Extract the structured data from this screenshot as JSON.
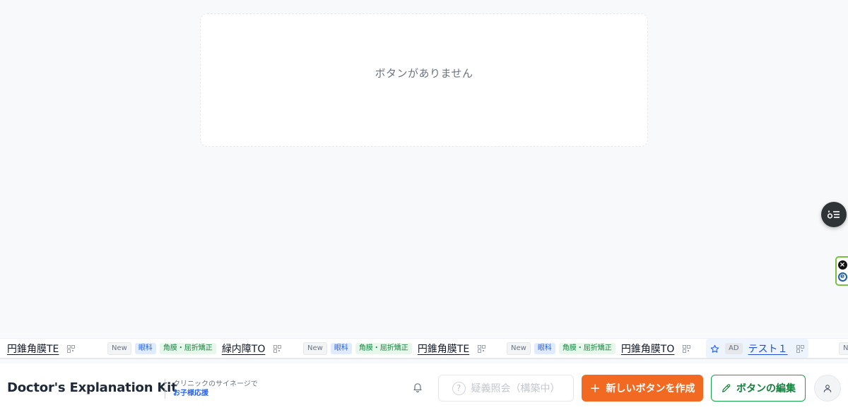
{
  "empty_state": {
    "message": "ボタンがありません"
  },
  "ticker": {
    "items": [
      {
        "title": "円錐角膜TE"
      },
      {
        "badge_new": "New",
        "badge_dept": "眼科",
        "badge_tag": "角膜・屈折矯正",
        "title": "緑内障TO"
      },
      {
        "badge_new": "New",
        "badge_dept": "眼科",
        "badge_tag": "角膜・屈折矯正",
        "title": "円錐角膜TE"
      },
      {
        "badge_new": "New",
        "badge_dept": "眼科",
        "badge_tag": "角膜・屈折矯正",
        "title": "円錐角膜TO"
      },
      {
        "badge_ad": "AD",
        "title": "テスト１"
      },
      {
        "badge_new": "Ne"
      }
    ]
  },
  "bottombar": {
    "brand": "Doctor's Explanation Kit",
    "tagline_1": "クリニックのサイネージで",
    "tagline_2": "お子様応援",
    "query_button": "疑義照会（構築中）",
    "query_icon": "?",
    "create_button": "新しいボタンを作成",
    "create_icon": "+",
    "edit_button": "ボタンの編集"
  },
  "icons": {
    "float": "list-toggle-icon",
    "bell": "bell-icon",
    "qr": "qr-code-icon",
    "star": "star-icon",
    "pencil": "pencil-icon",
    "user": "user-icon"
  },
  "colors": {
    "accent_orange": "#f26a21",
    "edit_green": "#16a34a",
    "link_blue": "#2563eb",
    "tag_green": "#15803d"
  }
}
